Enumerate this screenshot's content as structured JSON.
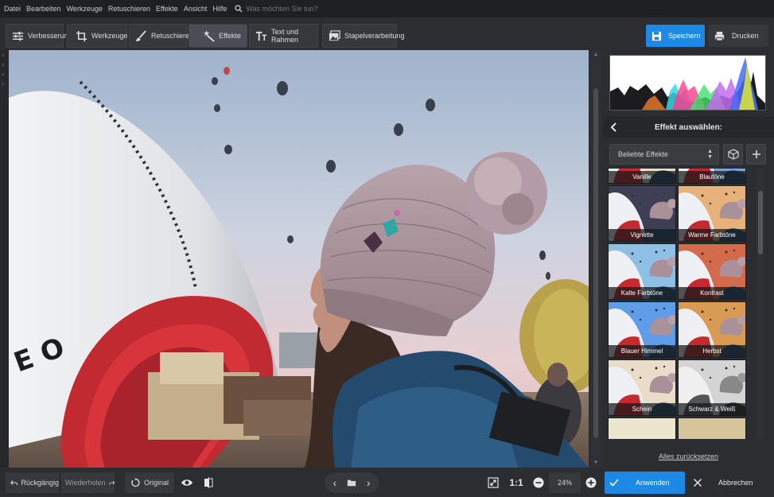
{
  "menu": {
    "items": [
      "Datei",
      "Bearbeiten",
      "Werkzeuge",
      "Retuschieren",
      "Effekte",
      "Ansicht",
      "Hilfe"
    ],
    "search_placeholder": "Was möchten Sie tun?"
  },
  "toolbar": {
    "tabs": [
      {
        "label": "Verbesserung",
        "icon": "sliders-icon"
      },
      {
        "label": "Werkzeuge",
        "icon": "crop-icon"
      },
      {
        "label": "Retuschieren",
        "icon": "brush-icon"
      },
      {
        "label": "Effekte",
        "icon": "magic-wand-icon",
        "active": true
      },
      {
        "label": "Text und Rahmen",
        "icon": "text-icon"
      },
      {
        "label": "Stapelverarbeitung",
        "icon": "batch-icon"
      }
    ],
    "save_label": "Speichern",
    "print_label": "Drucken"
  },
  "panel": {
    "header": "Effekt auswählen:",
    "dropdown_value": "Beliebte Effekte",
    "effects": [
      "Vanille",
      "Blautöne",
      "Vignette",
      "Warme Farbtöne",
      "Kalte Farbtöne",
      "Kontrast",
      "Blauer Himmel",
      "Herbst",
      "Schein",
      "Schwarz & Weiß"
    ],
    "reset_label": "Alles zurücksetzen"
  },
  "bottom": {
    "undo_label": "Rückgängig",
    "redo_label": "Wiederholen",
    "original_label": "Original",
    "ratio_label": "1:1",
    "zoom_value": "24%",
    "apply_label": "Anwenden",
    "cancel_label": "Abbrechen"
  },
  "colors": {
    "accent": "#1e88e5",
    "panel_bg": "#2b2d30",
    "menubar_bg": "#1f2023"
  }
}
